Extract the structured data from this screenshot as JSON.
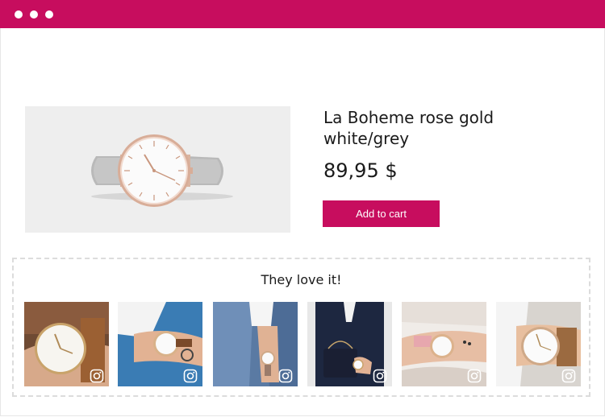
{
  "window": {
    "accent": "#c70d5e"
  },
  "product": {
    "title": "La Boheme rose gold white/grey",
    "price": "89,95 $",
    "add_to_cart_label": "Add to cart",
    "image_icon": "watch-product-image"
  },
  "ugc": {
    "heading": "They love it!",
    "photos": [
      {
        "icon": "instagram-icon"
      },
      {
        "icon": "instagram-icon"
      },
      {
        "icon": "instagram-icon"
      },
      {
        "icon": "instagram-icon"
      },
      {
        "icon": "instagram-icon"
      },
      {
        "icon": "instagram-icon"
      }
    ]
  }
}
